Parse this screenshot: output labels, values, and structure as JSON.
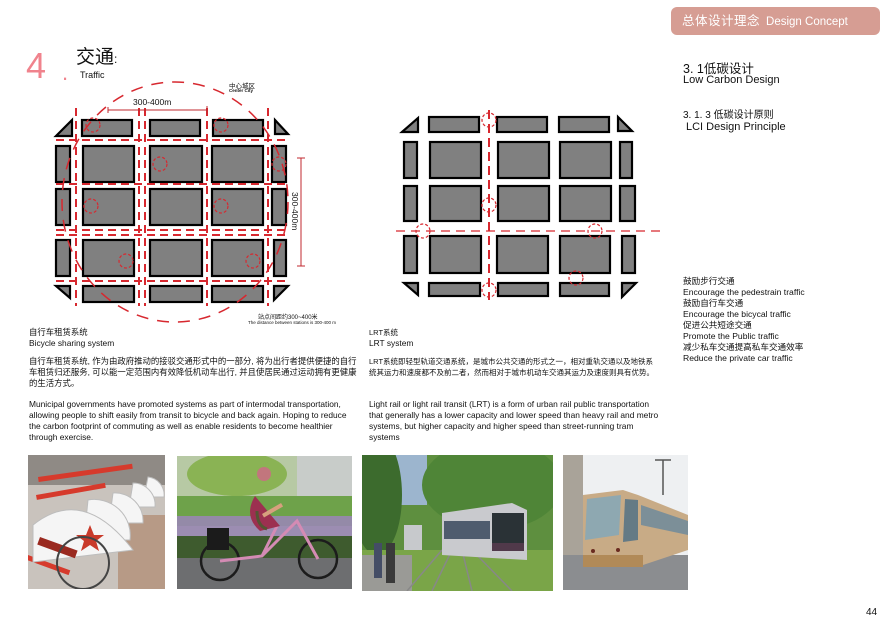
{
  "header": {
    "badge_zh": "总体设计理念",
    "badge_en": "Design Concept",
    "badge_color": "#d69d93"
  },
  "section": {
    "title_zh": "3. 1低碳设计",
    "title_en": "Low Carbon Design",
    "sub_zh": "3. 1. 3  低碳设计原则",
    "sub_en": "LCI Design Principle"
  },
  "principles": [
    "鼓励步行交通",
    "Encourage the pedestrain traffic",
    "鼓励自行车交通",
    "Encourage the bicycal traffic",
    "促进公共短途交通",
    "Promote the Public traffic",
    "减少私车交通提高私车交通效率",
    "Reduce the private car traffic"
  ],
  "chapter": {
    "number": "4",
    "dot": ".",
    "title_zh": "交通",
    "colon": ":",
    "title_en": "Traffic",
    "accent_color": "#f0838d"
  },
  "bike_map": {
    "center_zh": "中心城区",
    "center_en": "Center City",
    "dim_horizontal": "300-400m",
    "dim_vertical": "300-400m",
    "distance_zh": "站点间距约300~400米",
    "distance_en": "The distance between stations is 300-400 m"
  },
  "bike": {
    "heading_zh": "自行车租赁系统",
    "heading_en": "Bicycle sharing system",
    "para_zh": "自行车租赁系统, 作为由政府推动的接驳交通形式中的一部分, 将为出行者提供便捷的自行车租赁归还服务, 可以能一定范围内有效降低机动车出行, 并且使居民通过运动拥有更健康的生活方式。",
    "para_en": "Municipal governments have promoted systems as part of intermodal transportation, allowing people to shift easily from transit to bicycle and back again. Hoping to reduce the carbon footprint of commuting as well as enable residents to become healthier through exercise."
  },
  "lrt": {
    "heading_zh": "LRT系统",
    "heading_en": "LRT system",
    "para_zh": "LRT系统即轻型轨道交通系统，是城市公共交通的形式之一，相对重轨交通以及地铁系统其运力和速度都不及前二者，然而相对于城市机动车交通其运力及速度则具有优势。",
    "para_en": "Light rail or light rail transit (LRT) is a form of urban rail public transportation that generally has a lower capacity and lower speed than heavy rail and metro systems, but higher capacity and higher speed than street-running tram systems"
  },
  "photos": [
    {
      "name": "bike-share-dock-photo",
      "alt": "Row of red shared bicycles with white fenders"
    },
    {
      "name": "cyclist-photo",
      "alt": "Woman riding a pink bicycle past lavender"
    },
    {
      "name": "lrt-grass-track-photo",
      "alt": "Light rail tram on grass track among trees"
    },
    {
      "name": "lrt-gold-tram-photo",
      "alt": "Gold light rail tram in city street"
    }
  ],
  "page_number": "44"
}
